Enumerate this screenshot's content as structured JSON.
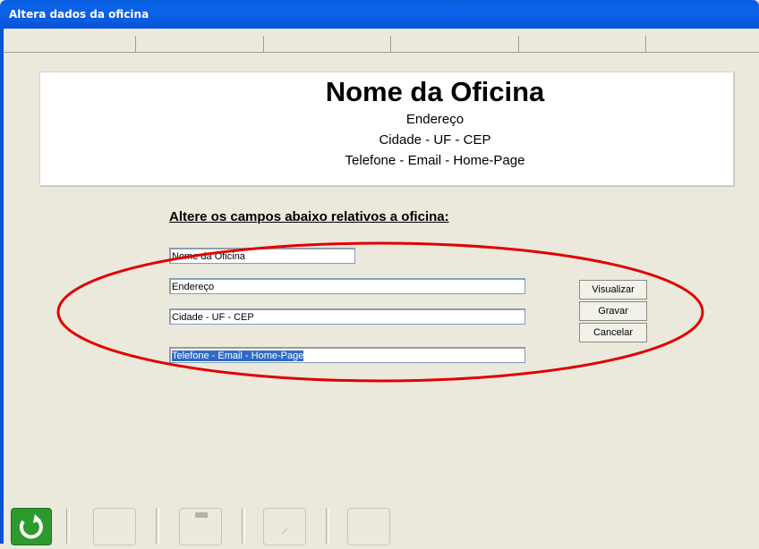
{
  "window": {
    "title": "Altera dados da oficina"
  },
  "preview": {
    "name": "Nome da Oficina",
    "address": "Endereço",
    "city_line": "Cidade - UF - CEP",
    "contact_line": "Telefone - Email - Home-Page"
  },
  "form": {
    "instruction": "Altere os campos abaixo relativos a oficina:",
    "fields": {
      "name": "Nome da Oficina",
      "address": "Endereço",
      "city": "Cidade - UF - CEP",
      "contact": "Telefone - Email - Home-Page"
    },
    "buttons": {
      "preview": "Visualizar",
      "save": "Gravar",
      "cancel": "Cancelar"
    }
  },
  "annotation": {
    "color": "#e00000"
  }
}
